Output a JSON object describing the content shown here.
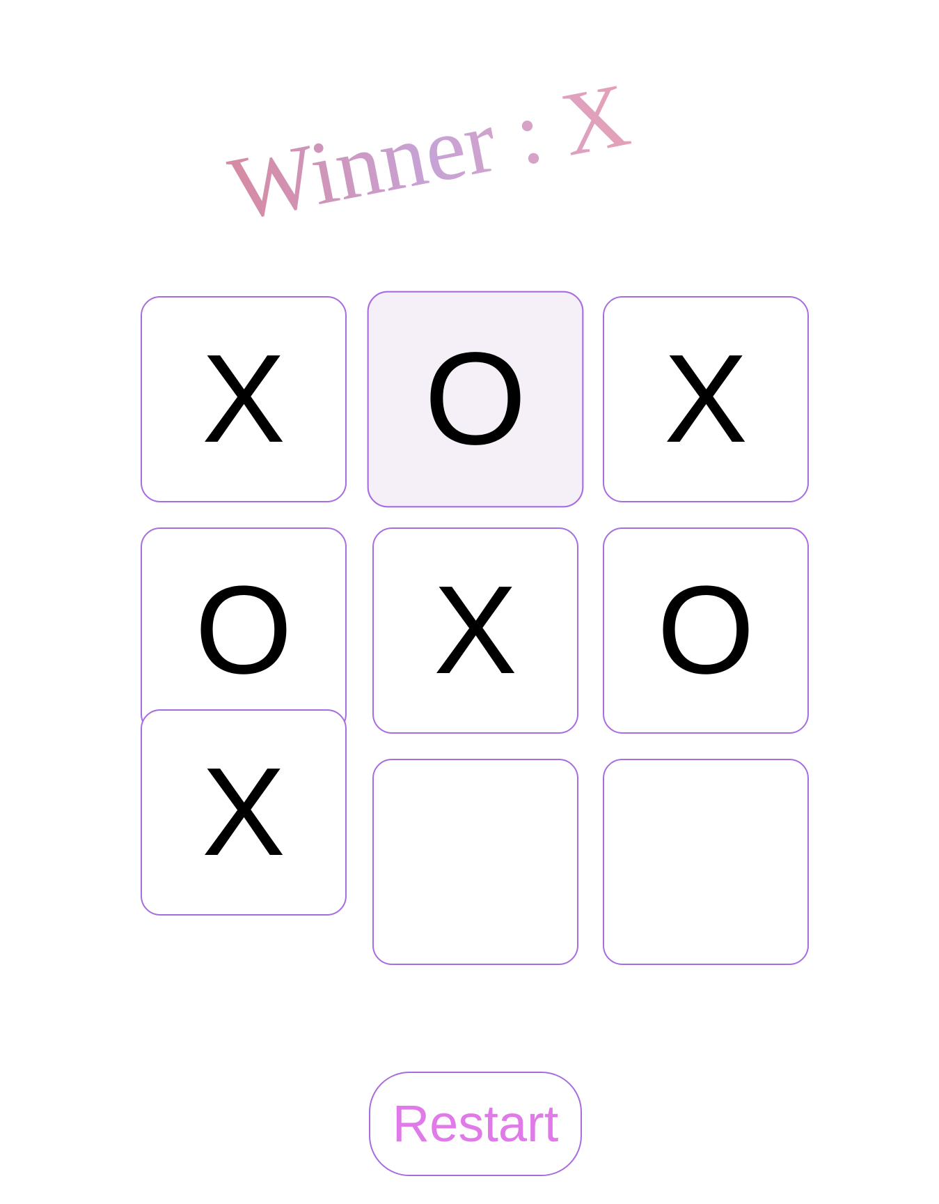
{
  "title": {
    "text": "Winner : X"
  },
  "board": {
    "cells": [
      {
        "value": "X",
        "selected": false
      },
      {
        "value": "O",
        "selected": true
      },
      {
        "value": "X",
        "selected": false
      },
      {
        "value": "O",
        "selected": false
      },
      {
        "value": "X",
        "selected": false
      },
      {
        "value": "O",
        "selected": false
      },
      {
        "value": "X",
        "selected": false
      },
      {
        "value": "",
        "selected": false
      },
      {
        "value": "",
        "selected": false
      }
    ]
  },
  "restart": {
    "label": "Restart"
  },
  "colors": {
    "accent_border": "#a86be0",
    "restart_text": "#e07ae8",
    "selected_cell_bg": "#f5f0f8"
  }
}
